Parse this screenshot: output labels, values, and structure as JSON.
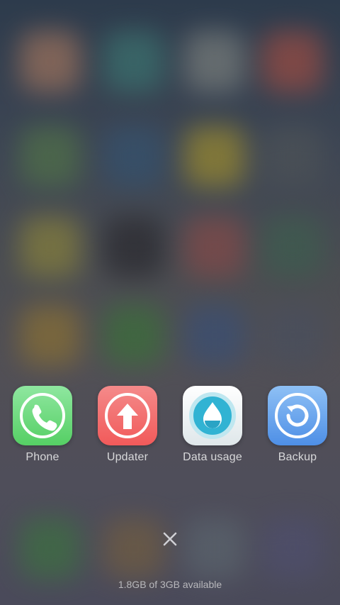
{
  "apps": [
    {
      "label": "Phone",
      "icon": "phone-icon",
      "color": "#5fd46a"
    },
    {
      "label": "Updater",
      "icon": "arrow-up-icon",
      "color": "#f36a6a"
    },
    {
      "label": "Data usage",
      "icon": "water-drop-icon",
      "color": "#2fb5d4"
    },
    {
      "label": "Backup",
      "icon": "restore-icon",
      "color": "#5a99e8"
    }
  ],
  "memory_info": "1.8GB of 3GB available",
  "close_icon": "close-icon"
}
